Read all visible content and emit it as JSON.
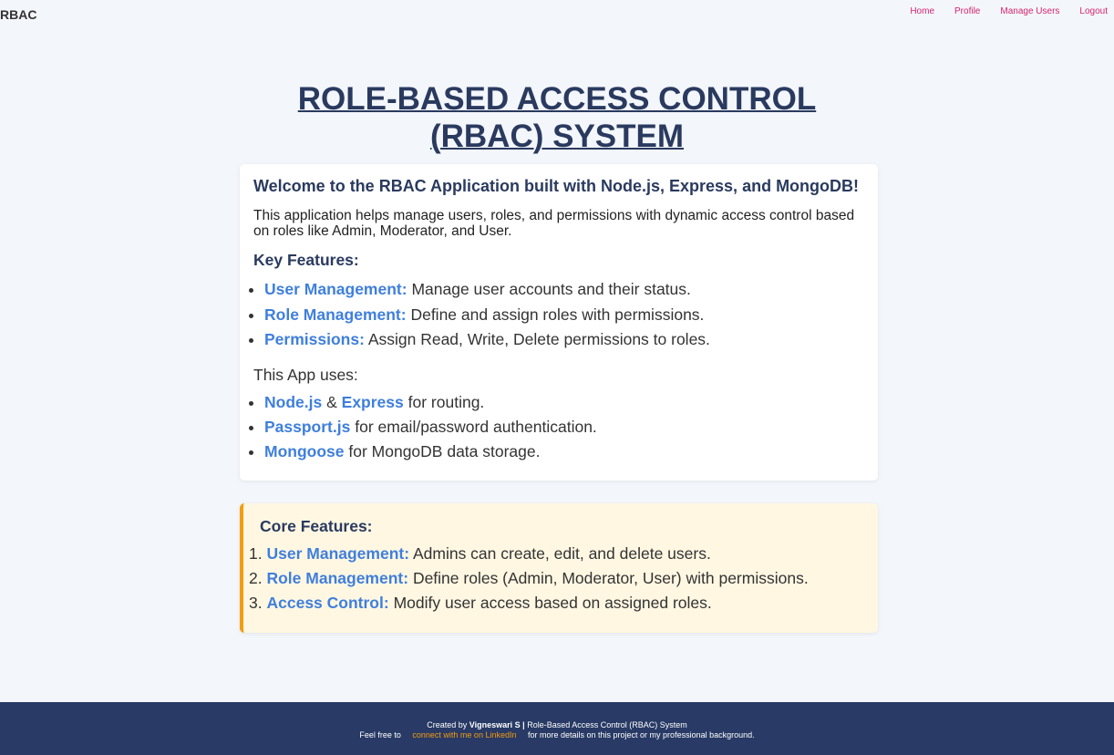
{
  "nav": {
    "brand": "RBAC",
    "links": [
      "Home",
      "Profile",
      "Manage Users",
      "Logout"
    ]
  },
  "title": "ROLE-BASED ACCESS CONTROL (RBAC) SYSTEM",
  "intro": {
    "heading": "Welcome to the RBAC Application built with Node.js, Express, and MongoDB!",
    "description": "This application helps manage users, roles, and permissions with dynamic access control based on roles like Admin, Moderator, and User.",
    "key_features_heading": "Key Features:",
    "key_features": [
      {
        "label": "User Management:",
        "text": "Manage user accounts and their status."
      },
      {
        "label": "Role Management:",
        "text": "Define and assign roles with permissions."
      },
      {
        "label": "Permissions:",
        "text": "Assign Read, Write, Delete permissions to roles."
      }
    ],
    "uses_heading": "This App uses:",
    "uses": [
      {
        "a": "Node.js",
        "mid": "&",
        "b": "Express",
        "text": "for routing."
      },
      {
        "a": "Passport.js",
        "text": "for email/password authentication."
      },
      {
        "a": "Mongoose",
        "text": "for MongoDB data storage."
      }
    ]
  },
  "core": {
    "heading": "Core Features:",
    "items": [
      {
        "num": "1.",
        "label": "User Management:",
        "text": "Admins can create, edit, and delete users."
      },
      {
        "num": "2.",
        "label": "Role Management:",
        "text": "Define roles (Admin, Moderator, User) with permissions."
      },
      {
        "num": "3.",
        "label": "Access Control:",
        "text": "Modify user access based on assigned roles."
      }
    ]
  },
  "footer": {
    "created_by": "Created by",
    "author": "Vigneswari S",
    "separator": "|",
    "system": "Role-Based Access Control (RBAC) System",
    "feel_free": "Feel free to",
    "link": "connect with me on LinkedIn",
    "rest": "for more details on this project or my professional background."
  },
  "colors": {
    "background": "#f3f6fb",
    "nav_link": "#d6246e",
    "heading": "#2a3a5f",
    "highlight": "#3f7fdc",
    "core_bg": "#fff7e2",
    "core_border": "#f39c12",
    "footer_bg": "#283a65"
  }
}
